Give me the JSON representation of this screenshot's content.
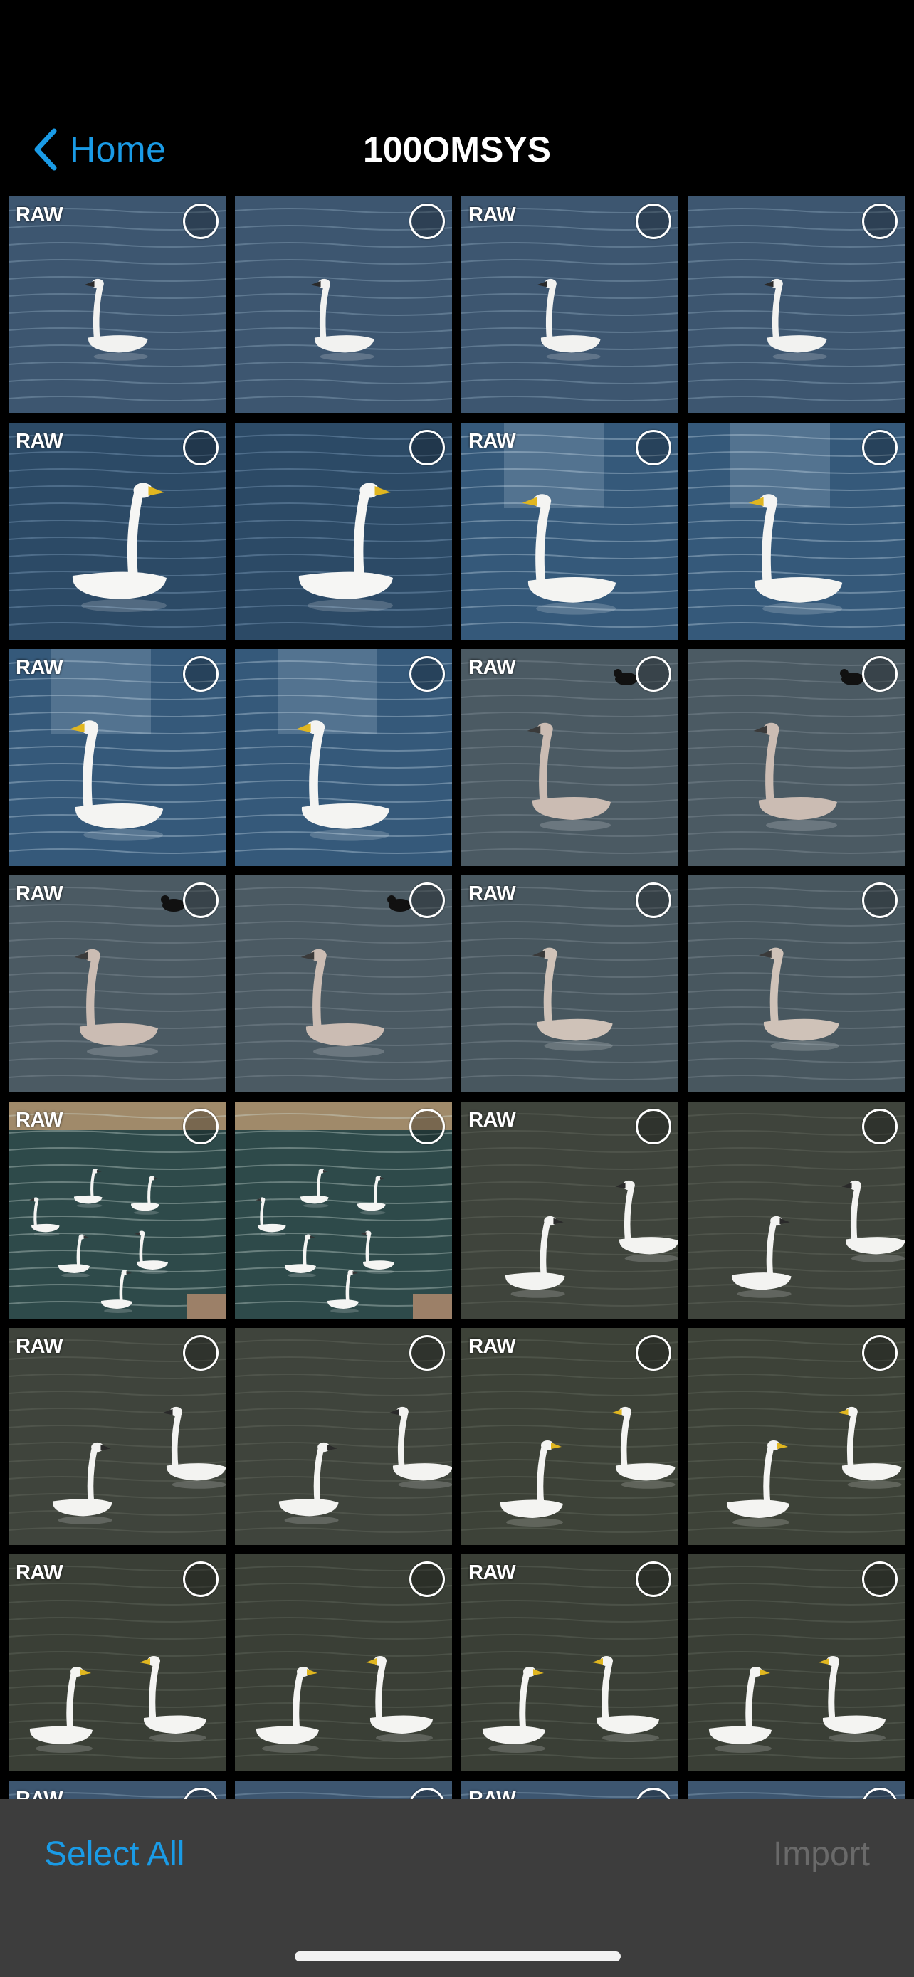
{
  "nav": {
    "back_label": "Home",
    "title": "100OMSYS"
  },
  "photos": {
    "badge_label": "RAW",
    "columns": 4,
    "items": [
      {
        "scene": "swan-far",
        "raw": true
      },
      {
        "scene": "swan-far",
        "raw": false
      },
      {
        "scene": "swan-far",
        "raw": true
      },
      {
        "scene": "swan-far",
        "raw": false
      },
      {
        "scene": "swan-close",
        "raw": true
      },
      {
        "scene": "swan-close",
        "raw": false
      },
      {
        "scene": "swan-ripple",
        "raw": true
      },
      {
        "scene": "swan-ripple",
        "raw": false
      },
      {
        "scene": "swan-ripple",
        "raw": true
      },
      {
        "scene": "swan-ripple",
        "raw": false
      },
      {
        "scene": "grey-swan-duck",
        "raw": true
      },
      {
        "scene": "grey-swan-duck",
        "raw": false
      },
      {
        "scene": "grey-swan-duck",
        "raw": true
      },
      {
        "scene": "grey-swan-duck",
        "raw": false
      },
      {
        "scene": "grey-swan-front",
        "raw": true
      },
      {
        "scene": "grey-swan-front",
        "raw": false
      },
      {
        "scene": "flock-shore",
        "raw": true
      },
      {
        "scene": "flock-shore",
        "raw": false
      },
      {
        "scene": "two-swans-dark",
        "raw": true
      },
      {
        "scene": "two-swans-dark",
        "raw": false
      },
      {
        "scene": "two-swans-dark",
        "raw": true
      },
      {
        "scene": "two-swans-dark",
        "raw": false
      },
      {
        "scene": "two-swans-yellow",
        "raw": true
      },
      {
        "scene": "two-swans-yellow",
        "raw": false
      },
      {
        "scene": "swans-facing",
        "raw": true
      },
      {
        "scene": "swans-facing",
        "raw": false
      },
      {
        "scene": "swans-facing",
        "raw": true
      },
      {
        "scene": "swans-facing",
        "raw": false
      },
      {
        "scene": "swan-far",
        "raw": true
      },
      {
        "scene": "swan-far",
        "raw": false
      },
      {
        "scene": "swan-far",
        "raw": true
      },
      {
        "scene": "swan-far",
        "raw": false
      }
    ]
  },
  "toolbar": {
    "select_all_label": "Select All",
    "import_label": "Import"
  },
  "colors": {
    "accent": "#1a9be6",
    "disabled": "#6a6a6a",
    "toolbar_bg": "#3d3d3d",
    "nav_bg": "#000000"
  },
  "icons": {
    "back": "chevron-left-icon",
    "select": "selection-circle-icon"
  }
}
